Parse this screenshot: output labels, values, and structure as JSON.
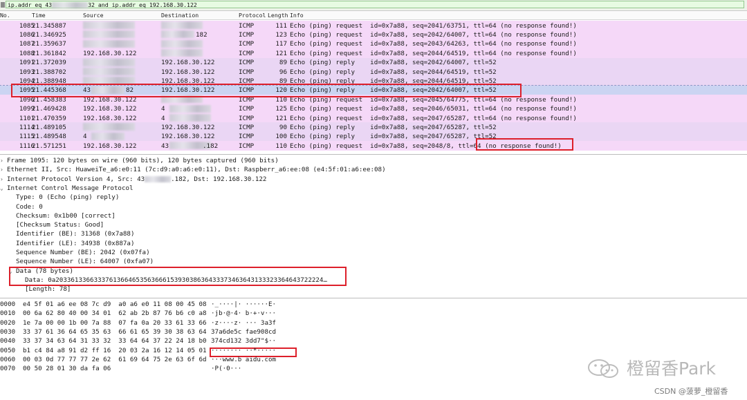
{
  "filter": {
    "text_part1": "ip.addr eq 43",
    "text_part2": "32 and ip.addr eq 192.168.30.122"
  },
  "columns": {
    "no": "No.",
    "time": "Time",
    "source": "Source",
    "destination": "Destination",
    "protocol": "Protocol",
    "length": "Length",
    "info": "Info"
  },
  "packets": [
    {
      "no": "1085",
      "time": "21.345887",
      "src": "",
      "dst": "",
      "proto": "ICMP",
      "len": "111",
      "info": "Echo (ping) request  id=0x7a88, seq=2041/63751, ttl=64 (no response found!)",
      "kind": "request"
    },
    {
      "no": "1086",
      "time": "21.346925",
      "src": "",
      "dst": "182",
      "proto": "ICMP",
      "len": "123",
      "info": "Echo (ping) request  id=0x7a88, seq=2042/64007, ttl=64 (no response found!)",
      "kind": "request"
    },
    {
      "no": "1087",
      "time": "21.359637",
      "src": "",
      "dst": "",
      "proto": "ICMP",
      "len": "117",
      "info": "Echo (ping) request  id=0x7a88, seq=2043/64263, ttl=64 (no response found!)",
      "kind": "request"
    },
    {
      "no": "1088",
      "time": "21.361842",
      "src": "192.168.30.122",
      "dst": "",
      "proto": "ICMP",
      "len": "121",
      "info": "Echo (ping) request  id=0x7a88, seq=2044/64519, ttl=64 (no response found!)",
      "kind": "request"
    },
    {
      "no": "1091",
      "time": "21.372039",
      "src": "",
      "dst": "192.168.30.122",
      "proto": "ICMP",
      "len": "89",
      "info": "Echo (ping) reply    id=0x7a88, seq=2042/64007, ttl=52",
      "kind": "reply"
    },
    {
      "no": "1093",
      "time": "21.388702",
      "src": "",
      "dst": "192.168.30.122",
      "proto": "ICMP",
      "len": "96",
      "info": "Echo (ping) reply    id=0x7a88, seq=2044/64519, ttl=52",
      "kind": "reply"
    },
    {
      "no": "1094",
      "time": "21.388948",
      "src": "",
      "dst": "192.168.30.122",
      "proto": "ICMP",
      "len": "89",
      "info": "Echo (ping) reply    id=0x7a88, seq=2044/64519, ttl=52",
      "kind": "reply"
    },
    {
      "no": "1095",
      "time": "21.445368",
      "src": "43",
      "src_tail": "82",
      "dst": "192.168.30.122",
      "proto": "ICMP",
      "len": "120",
      "info": "Echo (ping) reply    id=0x7a88, seq=2042/64007, ttl=52",
      "kind": "sel"
    },
    {
      "no": "1096",
      "time": "21.458383",
      "src": "192.168.30.122",
      "dst": "",
      "proto": "ICMP",
      "len": "110",
      "info": "Echo (ping) request  id=0x7a88, seq=2045/64775, ttl=64 (no response found!)",
      "kind": "request"
    },
    {
      "no": "1099",
      "time": "21.469428",
      "src": "192.168.30.122",
      "dst": "4",
      "proto": "ICMP",
      "len": "125",
      "info": "Echo (ping) request  id=0x7a88, seq=2046/65031, ttl=64 (no response found!)",
      "kind": "request"
    },
    {
      "no": "1101",
      "time": "21.470359",
      "src": "192.168.30.122",
      "dst": "4",
      "proto": "ICMP",
      "len": "121",
      "info": "Echo (ping) request  id=0x7a88, seq=2047/65287, ttl=64 (no response found!)",
      "kind": "request"
    },
    {
      "no": "1114",
      "time": "21.489105",
      "src": "",
      "dst": "192.168.30.122",
      "proto": "ICMP",
      "len": "90",
      "info": "Echo (ping) reply    id=0x7a88, seq=2047/65287, ttl=52",
      "kind": "reply"
    },
    {
      "no": "1115",
      "time": "21.489548",
      "src": "4",
      "dst": "192.168.30.122",
      "proto": "ICMP",
      "len": "100",
      "info": "Echo (ping) reply    id=0x7a88, seq=2047/65287, ttl=52",
      "kind": "reply"
    },
    {
      "no": "1116",
      "time": "21.571251",
      "src": "192.168.30.122",
      "dst": "43",
      "dst_tail": ".182",
      "proto": "ICMP",
      "len": "110",
      "info": "Echo (ping) request  id=0x7a88, seq=2048/8, ttl=64 (no response found!)",
      "kind": "request"
    }
  ],
  "details": [
    "Frame 1095: 120 bytes on wire (960 bits), 120 bytes captured (960 bits)",
    "Ethernet II, Src: HuaweiTe_a6:e0:11 (7c:d9:a0:a6:e0:11), Dst: Raspberr_a6:ee:08 (e4:5f:01:a6:ee:08)",
    "Internet Protocol Version 4, Src: 43",
    ".182, Dst: 192.168.30.122",
    "Internet Control Message Protocol",
    "Type: 0 (Echo (ping) reply)",
    "Code: 0",
    "Checksum: 0x1b00 [correct]",
    "[Checksum Status: Good]",
    "Identifier (BE): 31368 (0x7a88)",
    "Identifier (LE): 34938 (0x887a)",
    "Sequence Number (BE): 2042 (0x07fa)",
    "Sequence Number (LE): 64007 (0xfa07)",
    "Data (78 bytes)",
    "Data: 0a2033613366333761366465356366615393038636433373463643133323364643722224…",
    "[Length: 78]"
  ],
  "hex": [
    {
      "offset": "0000",
      "bytes": "e4 5f 01 a6 ee 08 7c d9  a0 a6 e0 11 08 00 45 08",
      "ascii": "·_····|· ······E·"
    },
    {
      "offset": "0010",
      "bytes": "00 6a 62 80 40 00 34 01  62 ab 2b 87 76 b6 c0 a8",
      "ascii": "·jb·@·4· b·+·v···"
    },
    {
      "offset": "0020",
      "bytes": "1e 7a 00 00 1b 00 7a 88  07 fa 0a 20 33 61 33 66",
      "ascii": "·z····z· ··· 3a3f"
    },
    {
      "offset": "0030",
      "bytes": "33 37 61 36 64 65 35 63  66 61 65 39 30 38 63 64",
      "ascii": "37a6de5c fae908cd"
    },
    {
      "offset": "0040",
      "bytes": "33 37 34 63 64 31 33 32  33 64 64 37 22 24 18 b0",
      "ascii": "374cd132 3dd7\"$··"
    },
    {
      "offset": "0050",
      "bytes": "b1 c4 84 a8 91 d2 ff 16  20 03 2a 16 12 14 05 01",
      "ascii": "········ ··*·····"
    },
    {
      "offset": "0060",
      "bytes": "00 03 0d 77 77 77 2e 62  61 69 64 75 2e 63 6f 6d",
      "ascii": "···www.b aidu.com"
    },
    {
      "offset": "0070",
      "bytes": "00 50 28 01 30 da fa 06",
      "ascii": "·P(·0···"
    }
  ],
  "watermark": {
    "text": "橙留香Park",
    "csdn": "CSDN @菠萝_橙留香"
  },
  "colors": {
    "request_row": "#f5d8f8",
    "reply_row": "#ead6f4",
    "selected_row": "#cbd4f2",
    "annotation_red": "#dd1f2a"
  }
}
